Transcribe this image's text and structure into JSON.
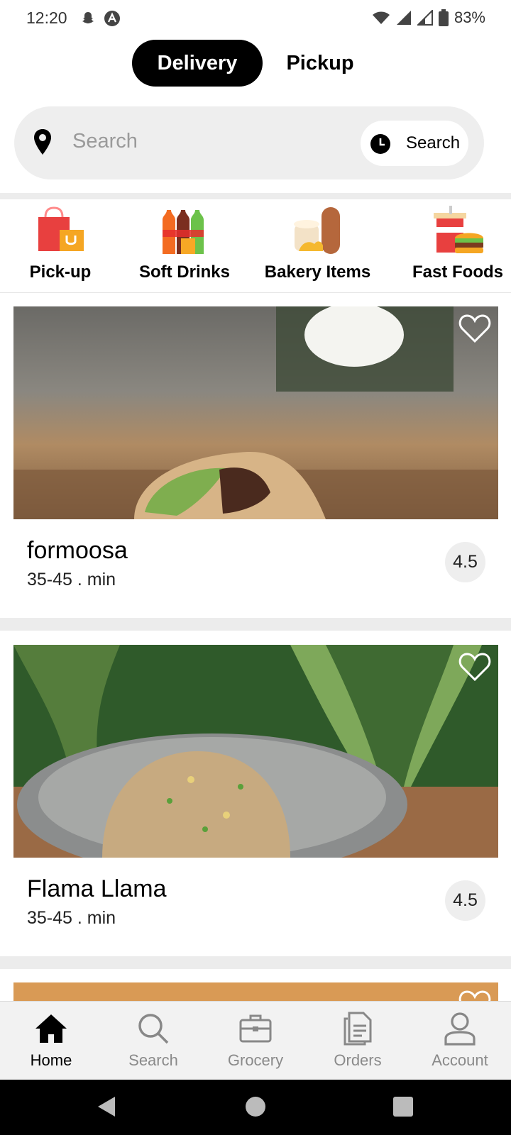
{
  "status_bar": {
    "time": "12:20",
    "battery": "83%"
  },
  "mode_toggle": {
    "active": "Delivery",
    "inactive": "Pickup"
  },
  "search": {
    "placeholder": "Search",
    "schedule_button": "Search"
  },
  "categories": [
    {
      "label": "Pick-up",
      "icon": "shopping-bags-icon"
    },
    {
      "label": "Soft Drinks",
      "icon": "soda-bottles-icon"
    },
    {
      "label": "Bakery Items",
      "icon": "bread-icon"
    },
    {
      "label": "Fast Foods",
      "icon": "burger-drink-icon"
    }
  ],
  "restaurants": [
    {
      "name": "formoosa",
      "eta": "35-45 . min",
      "rating": "4.5"
    },
    {
      "name": "Flama Llama",
      "eta": "35-45 . min",
      "rating": "4.5"
    }
  ],
  "bottom_nav": [
    {
      "label": "Home",
      "icon": "home-icon",
      "active": true
    },
    {
      "label": "Search",
      "icon": "search-icon",
      "active": false
    },
    {
      "label": "Grocery",
      "icon": "briefcase-icon",
      "active": false
    },
    {
      "label": "Orders",
      "icon": "documents-icon",
      "active": false
    },
    {
      "label": "Account",
      "icon": "user-icon",
      "active": false
    }
  ],
  "colors": {
    "accent": "#000000",
    "surface": "#eeeeee",
    "inactive_nav": "#8a8a8a"
  }
}
